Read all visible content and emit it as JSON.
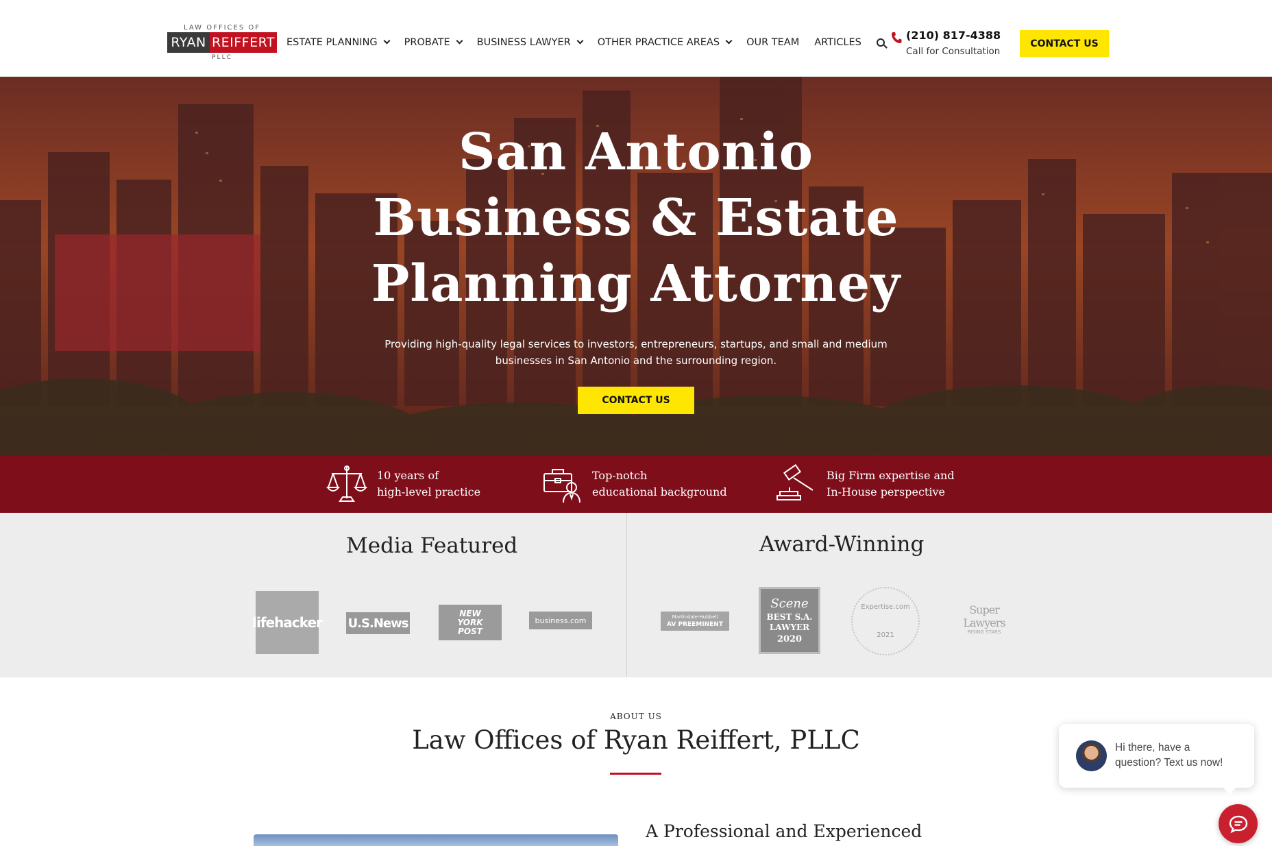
{
  "logo": {
    "top": "LAW OFFICES OF",
    "name_part1": "RYAN",
    "name_part2": "REIFFERT",
    "suffix": "PLLC"
  },
  "nav": {
    "items": [
      {
        "label": "ESTATE PLANNING",
        "dropdown": true
      },
      {
        "label": "PROBATE",
        "dropdown": true
      },
      {
        "label": "BUSINESS LAWYER",
        "dropdown": true
      },
      {
        "label": "OTHER PRACTICE AREAS",
        "dropdown": true
      },
      {
        "label": "OUR TEAM",
        "dropdown": false
      },
      {
        "label": "ARTICLES",
        "dropdown": false
      }
    ],
    "search_icon": "search-icon"
  },
  "header": {
    "phone": "(210) 817-4388",
    "phone_sub": "Call for Consultation",
    "cta": "CONTACT US"
  },
  "hero": {
    "title_lines": [
      "San Antonio",
      "Business & Estate",
      "Planning Attorney"
    ],
    "subtitle_line1": "Providing high-quality legal services to investors, entrepreneurs, startups, and small and medium",
    "subtitle_line2": "businesses in San Antonio and the surrounding region.",
    "cta": "CONTACT US"
  },
  "features": [
    {
      "icon": "scales-icon",
      "line1": "10 years of",
      "line2": "high-level practice"
    },
    {
      "icon": "briefcase-person-icon",
      "line1": "Top-notch",
      "line2": "educational background"
    },
    {
      "icon": "gavel-icon",
      "line1": "Big Firm expertise and",
      "line2": "In-House perspective"
    }
  ],
  "media": {
    "title": "Media Featured",
    "logos": [
      "lifehacker",
      "U.S.News",
      "NEW YORK POST",
      "business.com"
    ]
  },
  "awards": {
    "title": "Award-Winning",
    "badges": [
      {
        "top": "Martindale-Hubbell",
        "main": "AV PREEMINENT"
      },
      {
        "top": "Scene",
        "main": "BEST S.A. LAWYER",
        "year": "2020"
      },
      {
        "top": "Expertise.com",
        "year": "2021"
      },
      {
        "main": "Super Lawyers",
        "sub": "RISING STARS"
      }
    ]
  },
  "about": {
    "eyebrow": "ABOUT US",
    "title": "Law Offices of Ryan Reiffert, PLLC",
    "subtitle": "A Professional and Experienced"
  },
  "chat": {
    "message_line1": "Hi there, have a",
    "message_line2": "question? Text us now!"
  },
  "colors": {
    "brand_red": "#c1121f",
    "band_red": "#7f0e1b",
    "cta_yellow": "#ffe600"
  }
}
